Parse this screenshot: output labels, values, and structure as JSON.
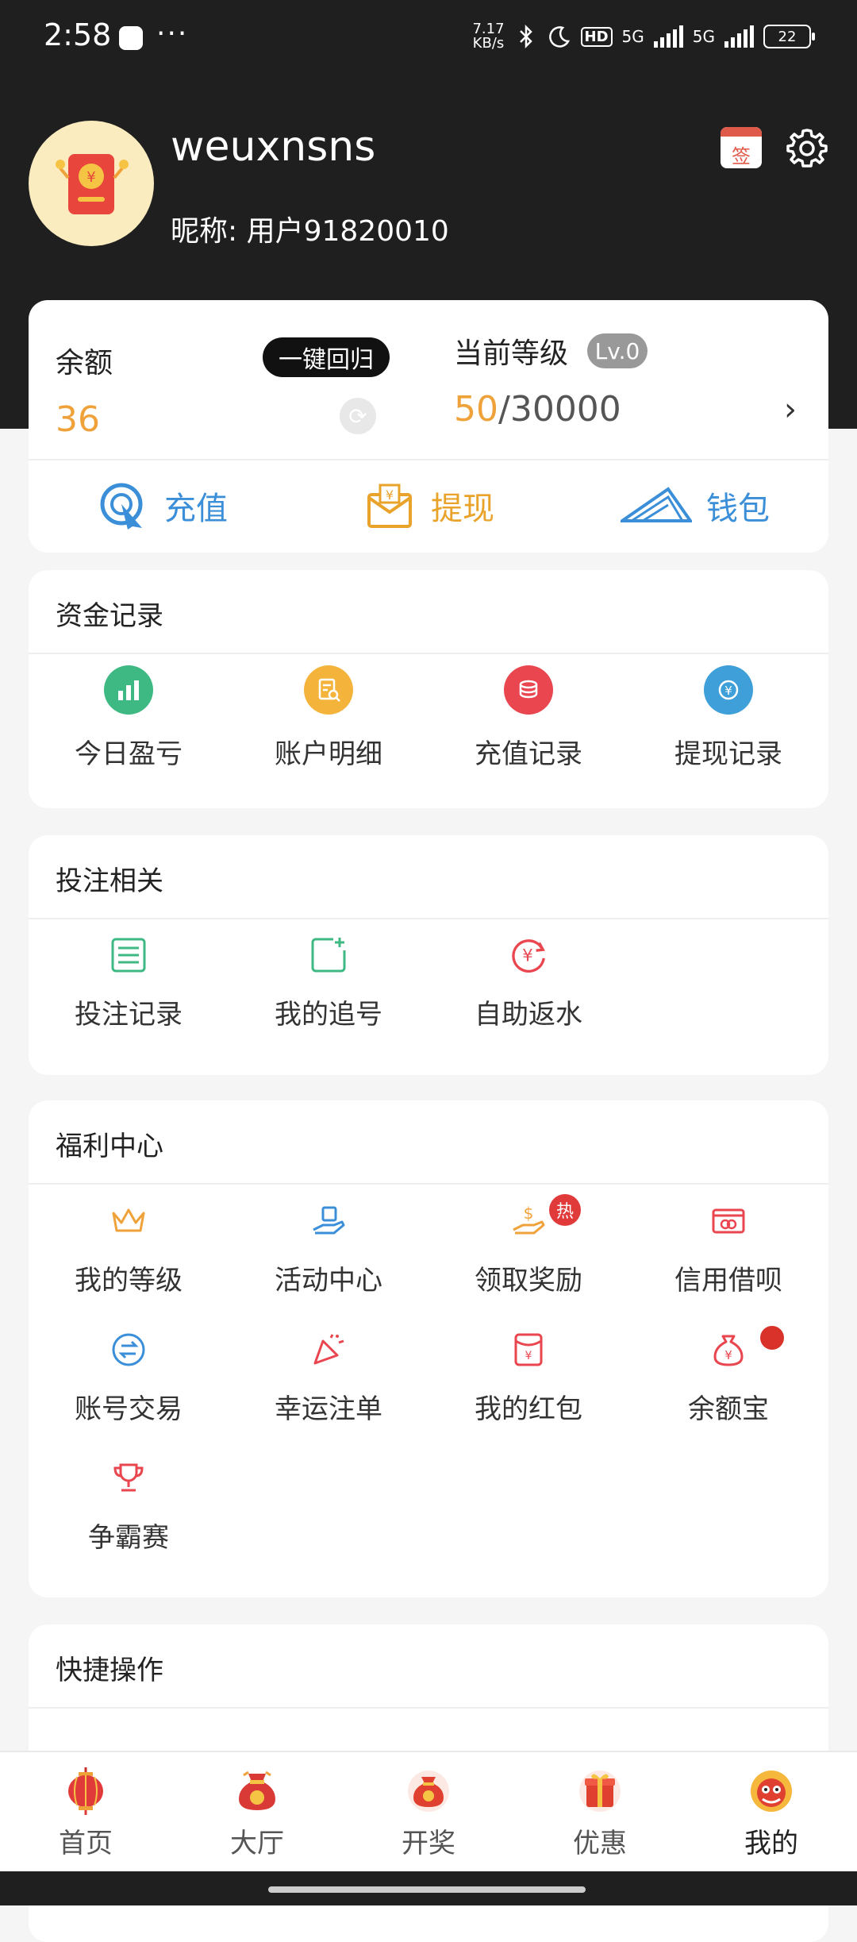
{
  "status_bar": {
    "time": "2:58",
    "more": "···",
    "net_speed_value": "7.17",
    "net_speed_unit": "KB/s",
    "hd": "HD",
    "network_1": "5G",
    "network_2": "5G",
    "battery": "22"
  },
  "profile": {
    "username": "weuxnsns",
    "nickname": "昵称: 用户91820010",
    "sign_label": "签"
  },
  "balance": {
    "label": "余额",
    "value": "36",
    "return_button": "一键回归",
    "level_label": "当前等级",
    "level_badge": "Lv.0",
    "level_current": "50",
    "level_total": "/30000"
  },
  "actions": [
    {
      "label": "充值",
      "icon": "recharge-icon"
    },
    {
      "label": "提现",
      "icon": "withdraw-icon"
    },
    {
      "label": "钱包",
      "icon": "wallet-icon"
    }
  ],
  "fund_records": {
    "title": "资金记录",
    "items": [
      {
        "label": "今日盈亏",
        "icon": "bar-chart-icon",
        "color": "#3fb984"
      },
      {
        "label": "账户明细",
        "icon": "document-search-icon",
        "color": "#f4b43c"
      },
      {
        "label": "充值记录",
        "icon": "coins-icon",
        "color": "#e9464f"
      },
      {
        "label": "提现记录",
        "icon": "yen-cycle-icon",
        "color": "#3f9fd8"
      }
    ]
  },
  "bet": {
    "title": "投注相关",
    "items": [
      {
        "label": "投注记录",
        "icon": "list-icon"
      },
      {
        "label": "我的追号",
        "icon": "add-note-icon"
      },
      {
        "label": "自助返水",
        "icon": "yen-refresh-icon"
      }
    ]
  },
  "welfare": {
    "title": "福利中心",
    "hot_badge": "热",
    "items": [
      {
        "label": "我的等级",
        "icon": "crown-icon"
      },
      {
        "label": "活动中心",
        "icon": "gift-hand-icon"
      },
      {
        "label": "领取奖励",
        "icon": "dollar-hand-icon"
      },
      {
        "label": "信用借呗",
        "icon": "card-icon"
      },
      {
        "label": "账号交易",
        "icon": "exchange-icon"
      },
      {
        "label": "幸运注单",
        "icon": "party-popper-icon"
      },
      {
        "label": "我的红包",
        "icon": "red-envelope-icon"
      },
      {
        "label": "余额宝",
        "icon": "money-bag-icon"
      },
      {
        "label": "争霸赛",
        "icon": "trophy-icon"
      }
    ]
  },
  "quick": {
    "title": "快捷操作"
  },
  "bottom_nav": [
    {
      "label": "首页",
      "icon": "lantern-icon"
    },
    {
      "label": "大厅",
      "icon": "lucky-bag-icon"
    },
    {
      "label": "开奖",
      "icon": "money-pouch-icon"
    },
    {
      "label": "优惠",
      "icon": "gift-box-icon"
    },
    {
      "label": "我的",
      "icon": "lion-icon"
    }
  ]
}
